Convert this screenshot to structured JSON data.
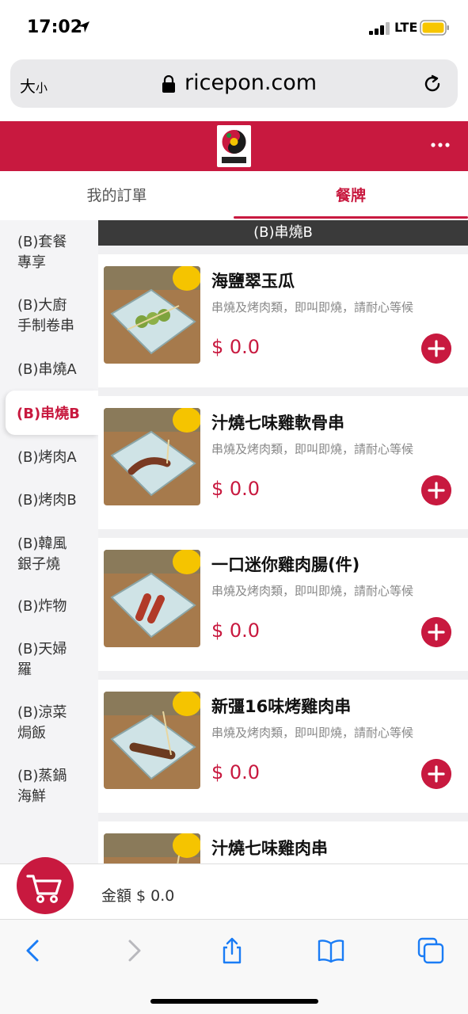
{
  "status_bar": {
    "time": "17:02",
    "network": "LTE"
  },
  "browser": {
    "text_size_big": "大",
    "text_size_small": "小",
    "url": "ricepon.com"
  },
  "app": {
    "brand_color": "#c8193f"
  },
  "tabs": {
    "orders": "我的訂單",
    "menu": "餐牌"
  },
  "sidebar": {
    "items": [
      {
        "line1": "(B)套餐",
        "line2": "專享"
      },
      {
        "line1": "(B)大廚",
        "line2": "手制卷串"
      },
      {
        "line1": "(B)串燒A",
        "line2": ""
      },
      {
        "line1": "(B)串燒B",
        "line2": ""
      },
      {
        "line1": "(B)烤肉A",
        "line2": ""
      },
      {
        "line1": "(B)烤肉B",
        "line2": ""
      },
      {
        "line1": "(B)韓風",
        "line2": "銀子燒"
      },
      {
        "line1": "(B)炸物",
        "line2": ""
      },
      {
        "line1": "(B)天婦",
        "line2": "羅"
      },
      {
        "line1": "(B)涼菜",
        "line2": "焗飯"
      },
      {
        "line1": "(B)蒸鍋",
        "line2": "海鮮"
      }
    ],
    "active": "(B)串燒B"
  },
  "category_header": "(B)串燒B",
  "items": [
    {
      "name": "海鹽翠玉瓜",
      "desc": "串燒及烤肉類，即叫即燒，請耐心等候",
      "price": "$ 0.0"
    },
    {
      "name": "汁燒七味雞軟骨串",
      "desc": "串燒及烤肉類，即叫即燒，請耐心等候",
      "price": "$ 0.0"
    },
    {
      "name": "一口迷你雞肉腸(件)",
      "desc": "串燒及烤肉類，即叫即燒，請耐心等候",
      "price": "$ 0.0"
    },
    {
      "name": "新彊16味烤雞肉串",
      "desc": "串燒及烤肉類，即叫即燒，請耐心等候",
      "price": "$ 0.0"
    },
    {
      "name": "汁燒七味雞肉串",
      "desc": "",
      "price": ""
    }
  ],
  "cart": {
    "total_label": "金額 $ 0.0"
  }
}
